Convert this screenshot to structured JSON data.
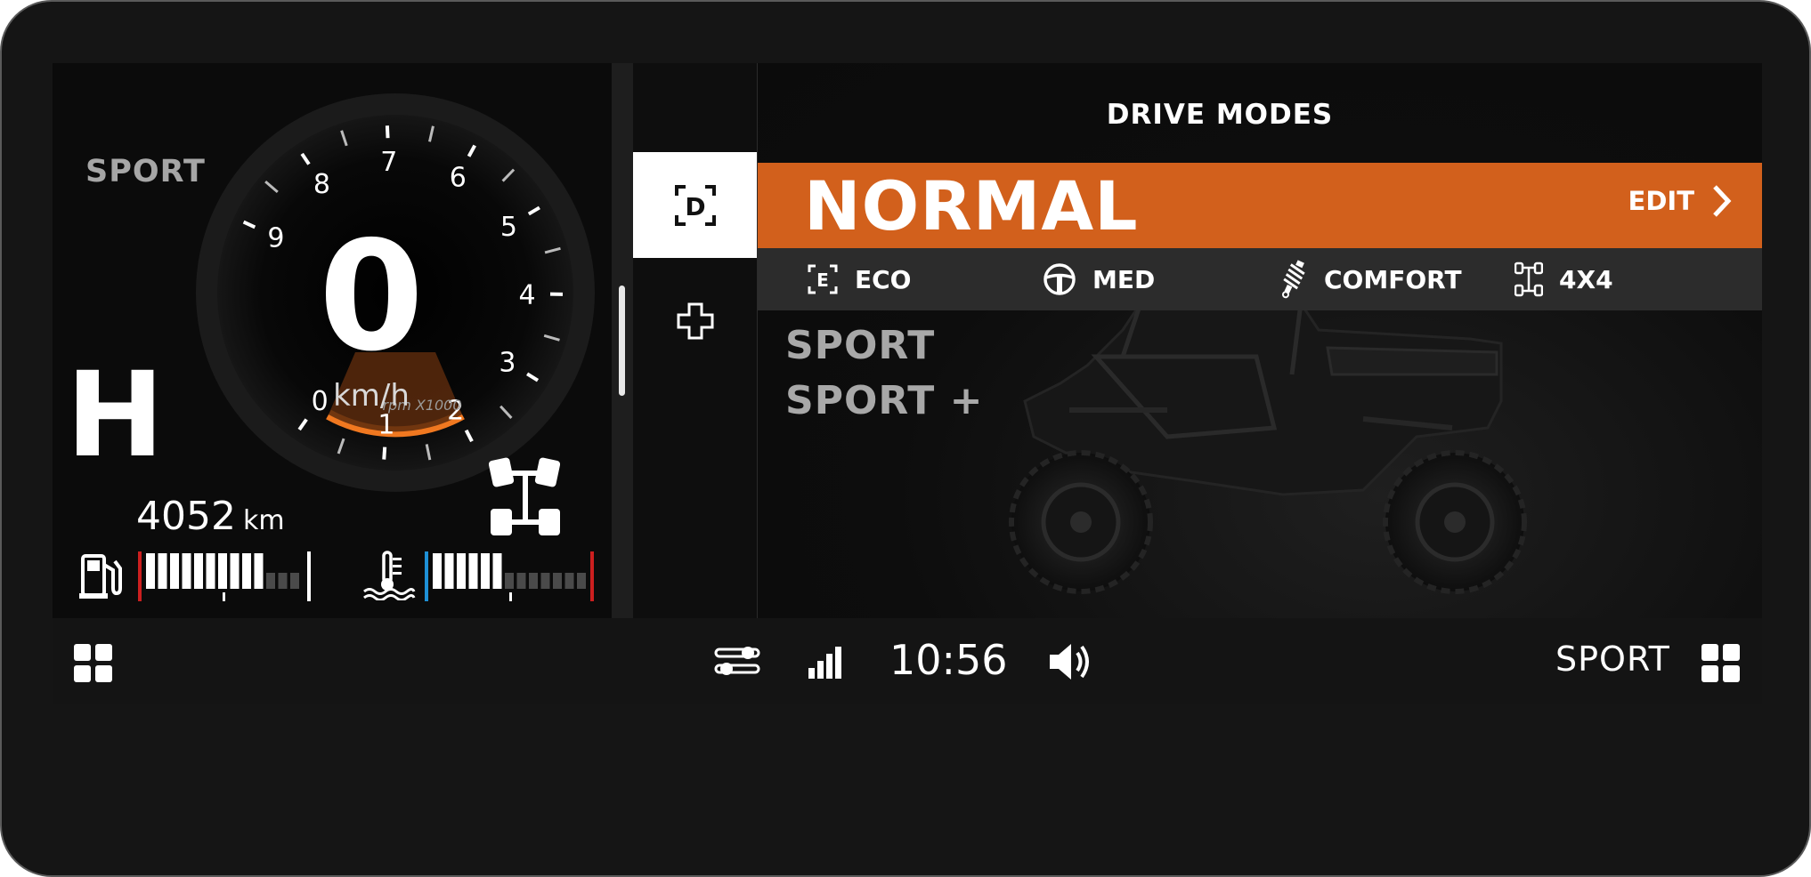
{
  "cluster": {
    "drive_mode": "SPORT",
    "gear": "H",
    "speed": "0",
    "speed_unit": "km/h",
    "rpm_unit": "rpm X1000",
    "rpm_ticks": [
      "0",
      "1",
      "2",
      "3",
      "4",
      "5",
      "6",
      "7",
      "8",
      "9"
    ],
    "rpm_value": 0,
    "odometer_value": "4052",
    "odometer_unit": "km",
    "fuel_icon": "fuel-pump-icon",
    "fuel_segments_total": 13,
    "fuel_segments_lit": 10,
    "temp_icon": "coolant-temperature-icon",
    "temp_segments_total": 13,
    "temp_segments_lit": 6,
    "drivetrain_icon": "4x4-drivetrain-icon"
  },
  "tabs": [
    {
      "icon": "drive-mode-icon",
      "glyph": "D",
      "active": true
    },
    {
      "icon": "plus-icon",
      "active": false
    }
  ],
  "drive_modes": {
    "title": "DRIVE MODES",
    "selected": "NORMAL",
    "edit_label": "EDIT",
    "parameters": [
      {
        "icon": "eco-icon",
        "label": "ECO"
      },
      {
        "icon": "steering-wheel-icon",
        "label": "MED"
      },
      {
        "icon": "suspension-shock-icon",
        "label": "COMFORT"
      },
      {
        "icon": "4x4-icon",
        "label": "4X4"
      }
    ],
    "options": [
      "SPORT",
      "SPORT +"
    ]
  },
  "status_bar": {
    "time": "10:56",
    "mode": "SPORT",
    "icons": [
      "apps-grid-icon",
      "settings-sliders-icon",
      "signal-icon",
      "volume-icon",
      "apps-grid-icon"
    ]
  },
  "colors": {
    "accent": "#d2601c",
    "background": "#0b0b0b",
    "gauge_orange": "#f07820",
    "fuel_low": "#cc1f1f",
    "temp_cold": "#1e90d6"
  }
}
